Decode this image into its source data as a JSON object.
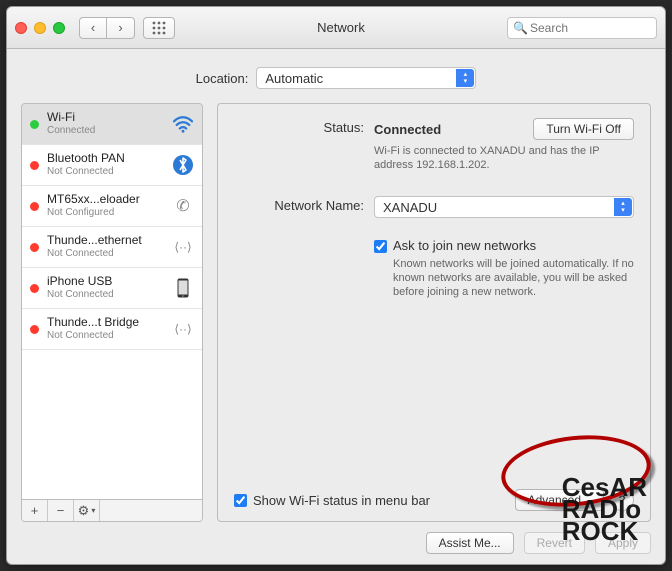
{
  "titlebar": {
    "title": "Network",
    "search_placeholder": "Search"
  },
  "location": {
    "label": "Location:",
    "value": "Automatic"
  },
  "sidebar": {
    "items": [
      {
        "name": "Wi-Fi",
        "status": "Connected",
        "dot": "green",
        "icon": "wifi",
        "selected": true
      },
      {
        "name": "Bluetooth PAN",
        "status": "Not Connected",
        "dot": "red",
        "icon": "bluetooth",
        "selected": false
      },
      {
        "name": "MT65xx...eloader",
        "status": "Not Configured",
        "dot": "red",
        "icon": "phone",
        "selected": false
      },
      {
        "name": "Thunde...ethernet",
        "status": "Not Connected",
        "dot": "red",
        "icon": "thunderbolt",
        "selected": false
      },
      {
        "name": "iPhone USB",
        "status": "Not Connected",
        "dot": "red",
        "icon": "iphone",
        "selected": false
      },
      {
        "name": "Thunde...t Bridge",
        "status": "Not Connected",
        "dot": "red",
        "icon": "thunderbolt",
        "selected": false
      }
    ],
    "footer": {
      "add": "+",
      "remove": "−",
      "actions": "⚙ ▾"
    }
  },
  "panel": {
    "status_label": "Status:",
    "status_value": "Connected",
    "turn_off_label": "Turn Wi-Fi Off",
    "status_desc": "Wi-Fi is connected to XANADU and has the IP address 192.168.1.202.",
    "network_name_label": "Network Name:",
    "network_name_value": "XANADU",
    "ask_join_label": "Ask to join new networks",
    "ask_join_desc": "Known networks will be joined automatically. If no known networks are available, you will be asked before joining a new network.",
    "show_menu_bar_label": "Show Wi-Fi status in menu bar",
    "advanced_label": "Advanced...",
    "help_label": "?"
  },
  "buttons": {
    "assist": "Assist Me...",
    "revert": "Revert",
    "apply": "Apply"
  },
  "watermark": {
    "l1": "CesAR",
    "l2": "RADIo",
    "l3": "ROCK"
  },
  "icons": {
    "chevron_left": "‹",
    "chevron_right": "›",
    "grid": "⋮⋮⋮",
    "search": "🔍",
    "updown": "▴▾"
  }
}
